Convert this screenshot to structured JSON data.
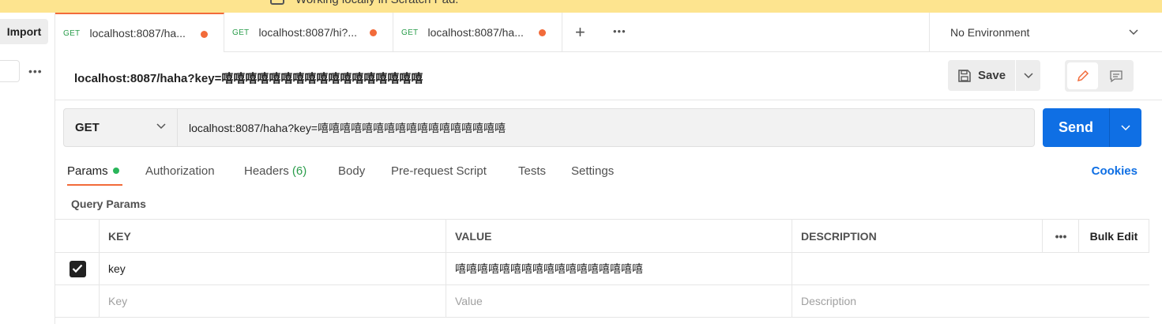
{
  "banner": {
    "text": "Working locally in Scratch Pad."
  },
  "left": {
    "import_label": "Import",
    "more": "•••"
  },
  "tabs": [
    {
      "method": "GET",
      "title": "localhost:8087/ha..."
    },
    {
      "method": "GET",
      "title": "localhost:8087/hi?..."
    },
    {
      "method": "GET",
      "title": "localhost:8087/ha..."
    }
  ],
  "tabs_bar": {
    "add": "+",
    "more": "•••"
  },
  "environment": {
    "selected": "No Environment"
  },
  "request": {
    "title": "localhost:8087/haha?key=嘻嘻嘻嘻嘻嘻嘻嘻嘻嘻嘻嘻嘻嘻嘻嘻嘻",
    "save_label": "Save",
    "method": "GET",
    "url": "localhost:8087/haha?key=嘻嘻嘻嘻嘻嘻嘻嘻嘻嘻嘻嘻嘻嘻嘻嘻嘻",
    "send_label": "Send"
  },
  "subtabs": {
    "params": "Params",
    "authorization": "Authorization",
    "headers": "Headers",
    "headers_count": "(6)",
    "body": "Body",
    "prerequest": "Pre-request Script",
    "tests": "Tests",
    "settings": "Settings",
    "cookies": "Cookies"
  },
  "query_params": {
    "label": "Query Params",
    "columns": {
      "key": "KEY",
      "value": "VALUE",
      "description": "DESCRIPTION",
      "more": "•••",
      "bulk_edit": "Bulk Edit"
    },
    "rows": [
      {
        "checked": true,
        "key": "key",
        "value": "嘻嘻嘻嘻嘻嘻嘻嘻嘻嘻嘻嘻嘻嘻嘻嘻嘻",
        "description": ""
      }
    ],
    "placeholders": {
      "key": "Key",
      "value": "Value",
      "description": "Description"
    }
  },
  "colors": {
    "accent": "#f26b3a",
    "primary": "#0f6fe4",
    "method_get": "#2a9d4b",
    "banner": "#fde48f"
  }
}
